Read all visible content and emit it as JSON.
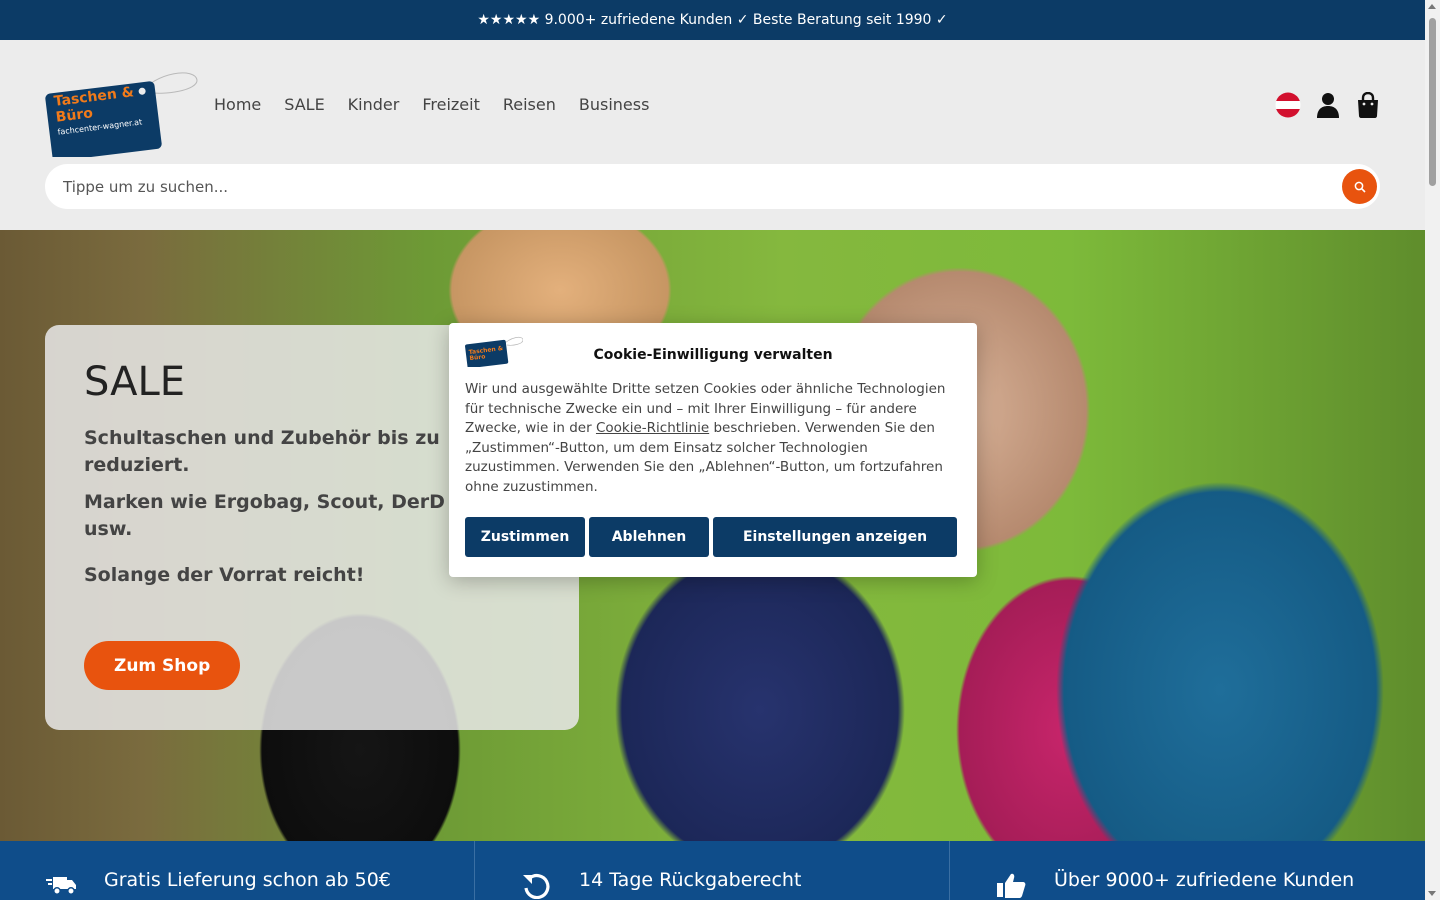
{
  "topbar": {
    "text": "★★★★★ 9.000+ zufriedene Kunden ✓ Beste Beratung seit 1990 ✓"
  },
  "logo": {
    "line1": "Taschen &",
    "line2": "Büro",
    "line3": "fachcenter-wagner.at"
  },
  "nav": {
    "items": [
      "Home",
      "SALE",
      "Kinder",
      "Freizeit",
      "Reisen",
      "Business"
    ]
  },
  "header_icons": [
    "austria-flag-icon",
    "user-icon",
    "shopping-bag-icon"
  ],
  "search": {
    "placeholder": "Tippe um zu suchen...",
    "icon": "search-icon"
  },
  "hero": {
    "title": "SALE",
    "line1": "Schultaschen und Zubehör bis zu",
    "line1b": "reduziert.",
    "line2": "Marken wie Ergobag, Scout, DerD",
    "line2b": "usw.",
    "line3": "Solange der Vorrat reicht!",
    "button": "Zum Shop"
  },
  "benefits": [
    {
      "icon": "delivery-truck-icon",
      "text": "Gratis Lieferung schon ab 50€"
    },
    {
      "icon": "return-arrow-icon",
      "text": "14 Tage Rückgaberecht"
    },
    {
      "icon": "thumbs-up-icon",
      "text": "Über 9000+ zufriedene Kunden"
    }
  ],
  "cookie": {
    "title": "Cookie-Einwilligung verwalten",
    "text_before_link": "Wir und ausgewählte Dritte setzen Cookies oder ähnliche Technologien für technische Zwecke ein und – mit Ihrer Einwilligung – für andere Zwecke, wie in der ",
    "link": "Cookie-Richtlinie",
    "text_after_link": " beschrieben. Verwenden Sie den „Zustimmen“-Button, um dem Einsatz solcher Technologien zuzustimmen. Verwenden Sie den „Ablehnen“-Button, um fortzufahren ohne zuzustimmen.",
    "accept": "Zustimmen",
    "reject": "Ablehnen",
    "settings": "Einstellungen anzeigen"
  },
  "colors": {
    "navy": "#0c3b66",
    "orange": "#e8530e",
    "benefit_bar": "#0f4d8a"
  }
}
